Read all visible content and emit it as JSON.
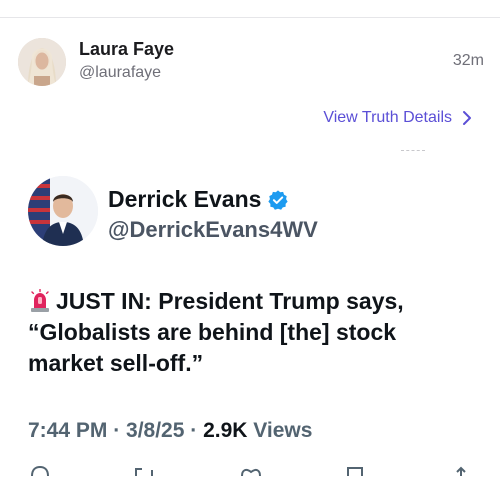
{
  "post": {
    "author_name": "Laura Faye",
    "author_handle": "@laurafaye",
    "time": "32m",
    "details_link": "View Truth Details"
  },
  "embed": {
    "name": "Derrick Evans",
    "handle": "@DerrickEvans4WV",
    "text": "JUST IN: President Trump says, “Globalists are behind [the] stock market sell-off.”",
    "meta": "7:44 PM · 3/8/25 · ",
    "views_count": "2.9K",
    "views_label": "Views",
    "verified_icon": "verified-badge-icon",
    "emoji_icon": "siren-icon"
  },
  "colors": {
    "link": "#5b4fd6",
    "verified": "#1d9bf0",
    "muted": "#6f6f78"
  }
}
